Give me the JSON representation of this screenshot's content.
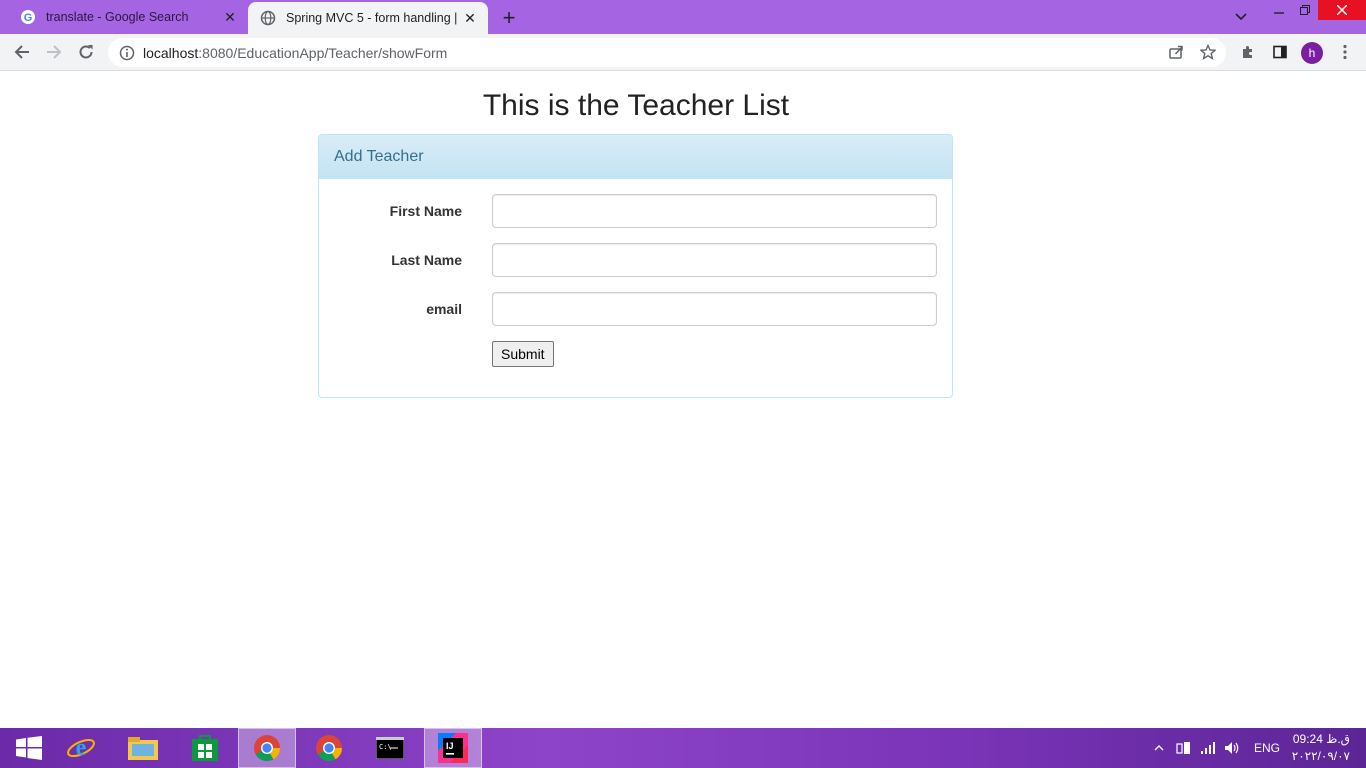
{
  "browser": {
    "tabs": [
      {
        "title": "translate - Google Search",
        "favicon": "google-icon",
        "active": false
      },
      {
        "title": "Spring MVC 5 - form handling | J",
        "favicon": "globe-icon",
        "active": true
      }
    ],
    "new_tab_label": "+",
    "url_host": "localhost",
    "url_rest": ":8080/EducationApp/Teacher/showForm",
    "avatar_letter": "h",
    "accent_color": "#a565e2"
  },
  "page": {
    "heading": "This is the Teacher List",
    "panel_title": "Add Teacher",
    "fields": [
      {
        "label": "First Name",
        "value": ""
      },
      {
        "label": "Last Name",
        "value": ""
      },
      {
        "label": "email",
        "value": ""
      }
    ],
    "submit_label": "Submit"
  },
  "taskbar": {
    "apps": [
      "windows-start-icon",
      "internet-explorer-icon",
      "file-explorer-icon",
      "store-icon",
      "chrome-icon",
      "chrome-icon",
      "command-prompt-icon",
      "intellij-icon"
    ],
    "language": "ENG",
    "time": "09:24 ق.ظ",
    "date": "۲۰۲۲/۰۹/۰۷"
  }
}
